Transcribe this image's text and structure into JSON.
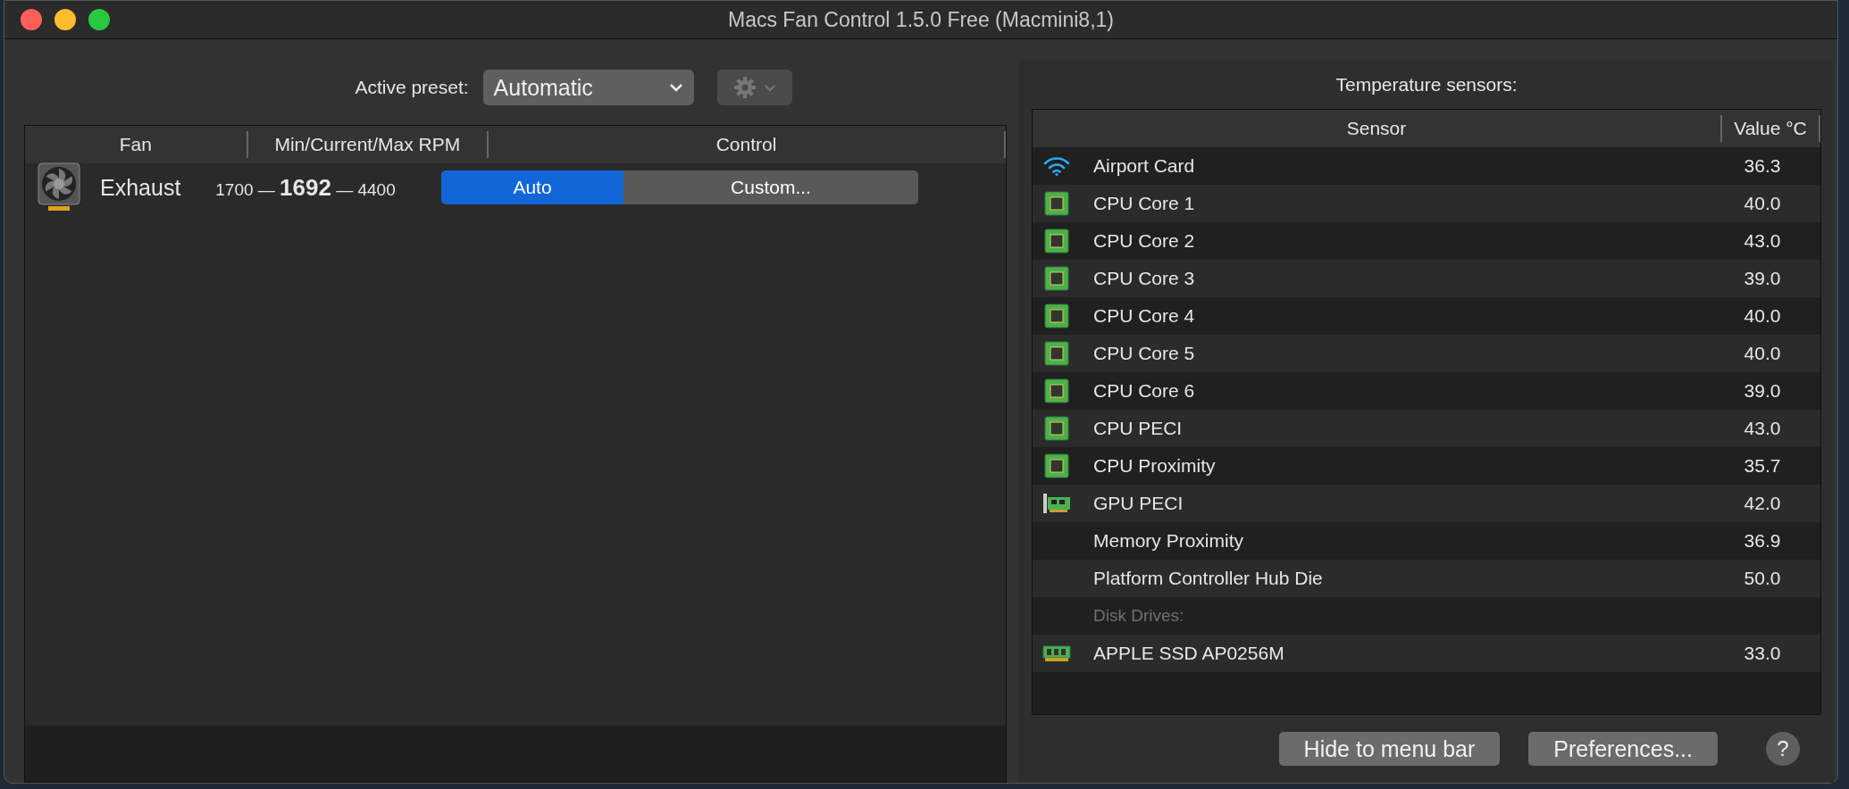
{
  "window": {
    "title": "Macs Fan Control 1.5.0 Free (Macmini8,1)"
  },
  "preset": {
    "label": "Active preset:",
    "value": "Automatic"
  },
  "fans_table": {
    "columns": [
      "Fan",
      "Min/Current/Max RPM",
      "Control"
    ],
    "rows": [
      {
        "name": "Exhaust",
        "rpm": "1700 — **1692** — 4400",
        "control": [
          {
            "label": "Auto",
            "selected": true
          },
          {
            "label": "Custom...",
            "selected": false
          }
        ]
      }
    ]
  },
  "sensors": {
    "title": "Temperature sensors:",
    "columns": [
      "Sensor",
      "Value °C"
    ],
    "rows": [
      {
        "kind": "wifi",
        "name": "Airport Card",
        "value": "36.3"
      },
      {
        "kind": "cpu",
        "name": "CPU Core 1",
        "value": "40.0"
      },
      {
        "kind": "cpu",
        "name": "CPU Core 2",
        "value": "43.0"
      },
      {
        "kind": "cpu",
        "name": "CPU Core 3",
        "value": "39.0"
      },
      {
        "kind": "cpu",
        "name": "CPU Core 4",
        "value": "40.0"
      },
      {
        "kind": "cpu",
        "name": "CPU Core 5",
        "value": "40.0"
      },
      {
        "kind": "cpu",
        "name": "CPU Core 6",
        "value": "39.0"
      },
      {
        "kind": "cpu",
        "name": "CPU PECI",
        "value": "43.0"
      },
      {
        "kind": "cpu",
        "name": "CPU Proximity",
        "value": "35.7"
      },
      {
        "kind": "gpu",
        "name": "GPU PECI",
        "value": "42.0"
      },
      {
        "kind": "plain",
        "name": "Memory Proximity",
        "value": "36.9"
      },
      {
        "kind": "plain",
        "name": "Platform Controller Hub Die",
        "value": "50.0"
      },
      {
        "kind": "group",
        "name": "Disk Drives:"
      },
      {
        "kind": "ssd",
        "name": "APPLE SSD AP0256M",
        "value": "33.0"
      }
    ]
  },
  "buttons": [
    "Hide to menu bar",
    "Preferences..."
  ],
  "help": "?"
}
